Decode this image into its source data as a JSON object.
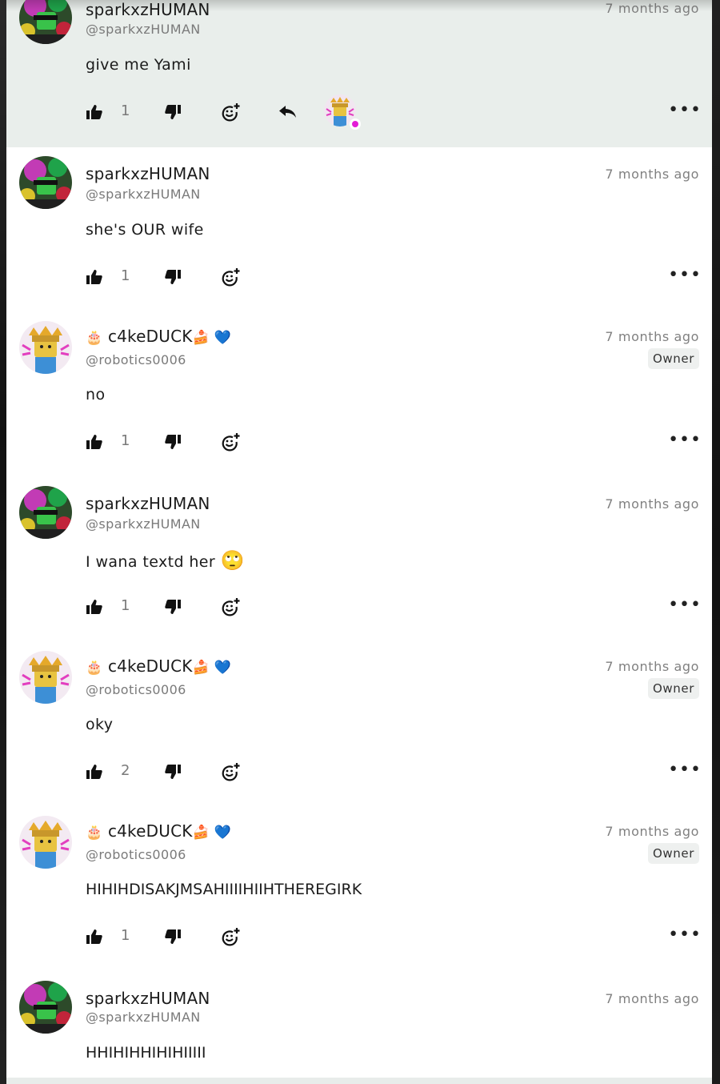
{
  "comments": [
    {
      "id": "c0",
      "name": "sparkxzHUMAN",
      "handle": "@sparkxzHUMAN",
      "time": "7 months ago",
      "text": "give me Yami",
      "likes": "1",
      "highlighted": true,
      "avatar": "sparkxz-avatar"
    },
    {
      "id": "c1",
      "name": "sparkxzHUMAN",
      "handle": "@sparkxzHUMAN",
      "time": "7 months ago",
      "text": "she's OUR wife",
      "likes": "1",
      "avatar": "sparkxz-avatar"
    },
    {
      "id": "c2",
      "name_prefix": "🎂",
      "name": "c4keDUCK",
      "name_suffix": "🍰 💙",
      "handle": "@robotics0006",
      "time": "7 months ago",
      "badge": "Owner",
      "text": "no",
      "likes": "1",
      "avatar": "c4keduck-avatar"
    },
    {
      "id": "c3",
      "name": "sparkxzHUMAN",
      "handle": "@sparkxzHUMAN",
      "time": "7 months ago",
      "text": "I wana textd her",
      "text_emoji": "🙄",
      "likes": "1",
      "avatar": "sparkxz-avatar"
    },
    {
      "id": "c4",
      "name_prefix": "🎂",
      "name": "c4keDUCK",
      "name_suffix": "🍰 💙",
      "handle": "@robotics0006",
      "time": "7 months ago",
      "badge": "Owner",
      "text": "oky",
      "likes": "2",
      "avatar": "c4keduck-avatar"
    },
    {
      "id": "c5",
      "name_prefix": "🎂",
      "name": "c4keDUCK",
      "name_suffix": "🍰 💙",
      "handle": "@robotics0006",
      "time": "7 months ago",
      "badge": "Owner",
      "text": "HIHIHDISAKJMSAHIIIIHIIHTHEREGIRK",
      "likes": "1",
      "avatar": "c4keduck-avatar"
    },
    {
      "id": "c6",
      "name": "sparkxzHUMAN",
      "handle": "@sparkxzHUMAN",
      "time": "7 months ago",
      "text": "HHIHIHHIHIHIIIII",
      "avatar": "sparkxz-avatar"
    }
  ],
  "more_label": "•••",
  "colors": {
    "highlight_bg": "#e9eeeb",
    "reaction_dot": "#e31cd6",
    "badge_bg": "#eef0ef"
  }
}
